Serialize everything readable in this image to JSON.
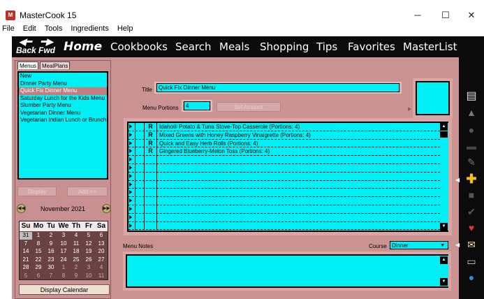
{
  "window": {
    "title": "MasterCook 15",
    "icon_text": "M",
    "minimize": "─",
    "maximize": "☐",
    "close": "✕"
  },
  "menubar": [
    "File",
    "Edit",
    "Tools",
    "Ingredients",
    "Help"
  ],
  "nav": {
    "back": "Back",
    "fwd": "Fwd",
    "home": "Home",
    "items": [
      "Cookbooks",
      "Search",
      "Meals",
      "Shopping",
      "Tips",
      "Favorites",
      "MasterList"
    ]
  },
  "left": {
    "tabs": [
      "Menus",
      "MealPlans"
    ],
    "menus": [
      "New",
      "Dinner Party Menu",
      "Quick Fix Dinner Menu",
      "Saturday Lunch for the Kids Menu",
      "Slumber Party Menu",
      "Vegetarian Dinner Menu",
      "Vegetarian Indian Lunch or Brunch"
    ],
    "selected_index": 2,
    "display_label": "Display",
    "add_label": "Add >>",
    "calendar": {
      "month": "November 2021",
      "days": [
        "Su",
        "Mo",
        "Tu",
        "We",
        "Th",
        "Fr",
        "Sa"
      ],
      "weeks": [
        [
          "31",
          "1",
          "2",
          "3",
          "4",
          "5",
          "6"
        ],
        [
          "7",
          "8",
          "9",
          "10",
          "11",
          "12",
          "13"
        ],
        [
          "14",
          "15",
          "16",
          "17",
          "18",
          "19",
          "20"
        ],
        [
          "21",
          "22",
          "23",
          "24",
          "25",
          "26",
          "27"
        ],
        [
          "28",
          "29",
          "30",
          "1",
          "2",
          "3",
          "4"
        ],
        [
          "5",
          "6",
          "7",
          "8",
          "9",
          "10",
          "11"
        ]
      ],
      "display_calendar_label": "Display Calendar"
    }
  },
  "menu": {
    "title_label": "Title",
    "title_value": "Quick Fix Dinner Menu",
    "portions_label": "Menu Portions",
    "portions_value": "4",
    "set_amount_label": "Set Amount",
    "recipes": [
      {
        "type": "R",
        "text": "Idaho® Potato & Tuna Stove-Top Casserole (Portions: 4)"
      },
      {
        "type": "R",
        "text": "Mixed Greens with Honey Raspberry Vinaigrette (Portions: 4)"
      },
      {
        "type": "R",
        "text": "Quick and Easy Herb Rolls (Portions: 4)"
      },
      {
        "type": "R",
        "text": "Gingered Blueberry-Melon Toss (Portions: 4)"
      },
      {
        "type": "",
        "text": ""
      },
      {
        "type": "",
        "text": ""
      },
      {
        "type": "",
        "text": ""
      },
      {
        "type": "",
        "text": ""
      },
      {
        "type": "",
        "text": ""
      },
      {
        "type": "",
        "text": ""
      },
      {
        "type": "",
        "text": ""
      },
      {
        "type": "",
        "text": ""
      },
      {
        "type": "",
        "text": ""
      }
    ],
    "notes_label": "Menu Notes",
    "course_label": "Course",
    "course_value": "Dinner"
  },
  "colors": {
    "background": "#cb9292",
    "field": "#00f0f5",
    "nav": "#0b0b0b"
  }
}
